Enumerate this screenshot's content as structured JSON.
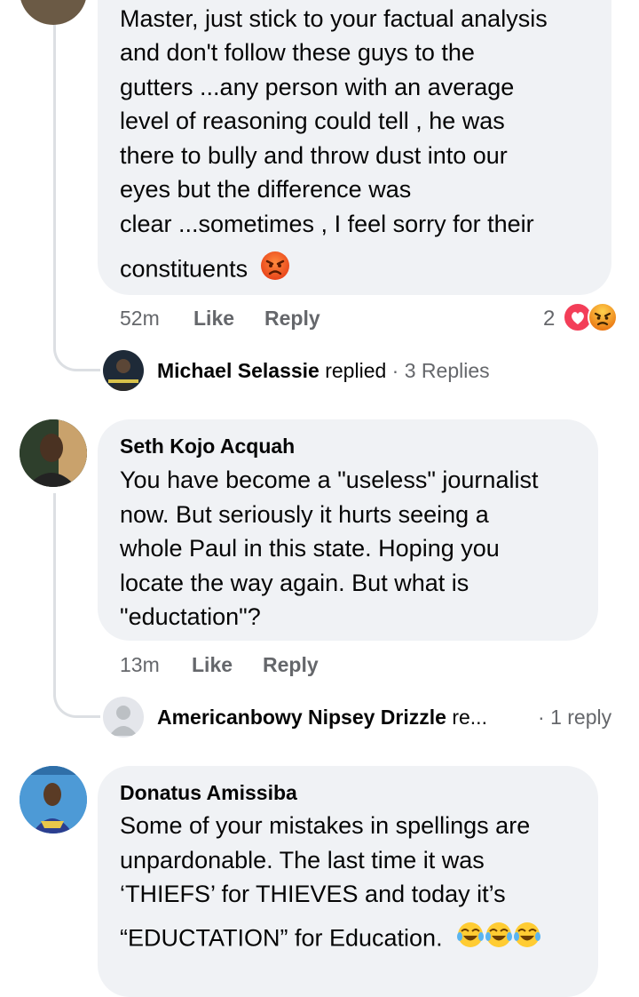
{
  "comment1": {
    "lines": [
      "Master, just stick to your factual analysis",
      "and don't follow these guys to the",
      "gutters ...any person with an average",
      "level of reasoning could tell , he was",
      "there to bully and throw dust into our",
      "eyes but the difference was",
      "clear ...sometimes , I feel sorry for their",
      "constituents"
    ],
    "emoji": "angry-face-icon",
    "time": "52m",
    "like": "Like",
    "reply": "Reply",
    "reaction_count": "2",
    "reactions": [
      "love-icon",
      "angry-icon"
    ]
  },
  "reply1": {
    "name": "Michael Selassie",
    "replied_word": " replied",
    "count": "3 Replies"
  },
  "comment2": {
    "name": "Seth Kojo Acquah",
    "lines": [
      "You have become a \"useless\" journalist",
      "now. But seriously it hurts seeing a",
      "whole Paul in this state. Hoping you",
      "locate the way again. But what is",
      "\"eductation\"?"
    ],
    "time": "13m",
    "like": "Like",
    "reply": "Reply"
  },
  "reply2": {
    "name": "Americanbowy Nipsey Drizzle",
    "replied_word": " re...",
    "count": "1 reply"
  },
  "comment3": {
    "name": "Donatus Amissiba",
    "lines": [
      "Some of your mistakes in spellings are",
      "unpardonable. The last time it was",
      "‘THIEFS’ for THIEVES and today it’s",
      "“EDUCTATION” for Education."
    ],
    "emojis": [
      "tears-of-joy-icon",
      "tears-of-joy-icon",
      "tears-of-joy-icon"
    ]
  },
  "colors": {
    "bubble": "#f0f2f5",
    "meta": "#65676b",
    "love": "#f33e58",
    "angry": "#e9710f"
  }
}
